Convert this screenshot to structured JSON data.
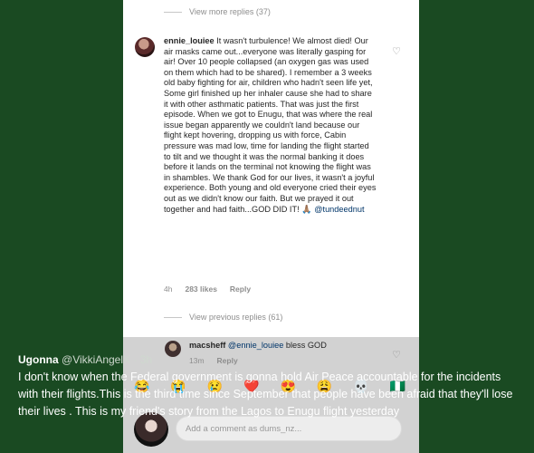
{
  "post": {
    "view_more_replies": "View more replies (37)",
    "comment": {
      "username": "ennie_louiee",
      "text": "It wasn't turbulence! We almost died! Our air masks came out...everyone was literally gasping for air! Over 10 people collapsed (an oxygen gas was used on them which had to be shared). I remember a 3 weeks old baby fighting for air, children who hadn't seen life yet, Some girl finished up her inhaler cause she had to share it with other asthmatic patients. That was just the first episode. When we got to Enugu, that was where the real issue began apparently we couldn't land because our flight kept hovering, dropping us with force, Cabin pressure was mad low, time for landing the flight started to tilt and we thought it was the normal banking it does before it lands on the terminal not knowing the flight was in shambles. We thank God for our lives, it wasn't a joyful experience. Both young and old everyone cried their eyes out as we didn't know our faith. But we prayed it out together and had faith...GOD DID IT! 🙏🏽",
      "mention": "@tundeednut",
      "time": "4h",
      "likes": "283 likes",
      "reply": "Reply"
    },
    "view_previous_replies": "View previous replies (61)",
    "reply": {
      "username": "macsheff",
      "mention": "@ennie_louiee",
      "text": "bless GOD",
      "time": "13m",
      "reply": "Reply"
    },
    "emojis": [
      "😂",
      "😭",
      "😢",
      "❤️",
      "😍",
      "😩",
      "💀",
      "🇳🇬"
    ],
    "comment_placeholder": "Add a comment as dums_nz..."
  },
  "tweet": {
    "name": "Ugonna",
    "handle": "@VikkiAngelX",
    "time": "· 3h",
    "text": "I don't know when the Federal government is gonna hold Air Peace accountable for the incidents with their flights.This is the third time since September that people have been afraid that they'll lose their lives . This is my friend's story from the Lagos to Enugu flight yesterday"
  }
}
